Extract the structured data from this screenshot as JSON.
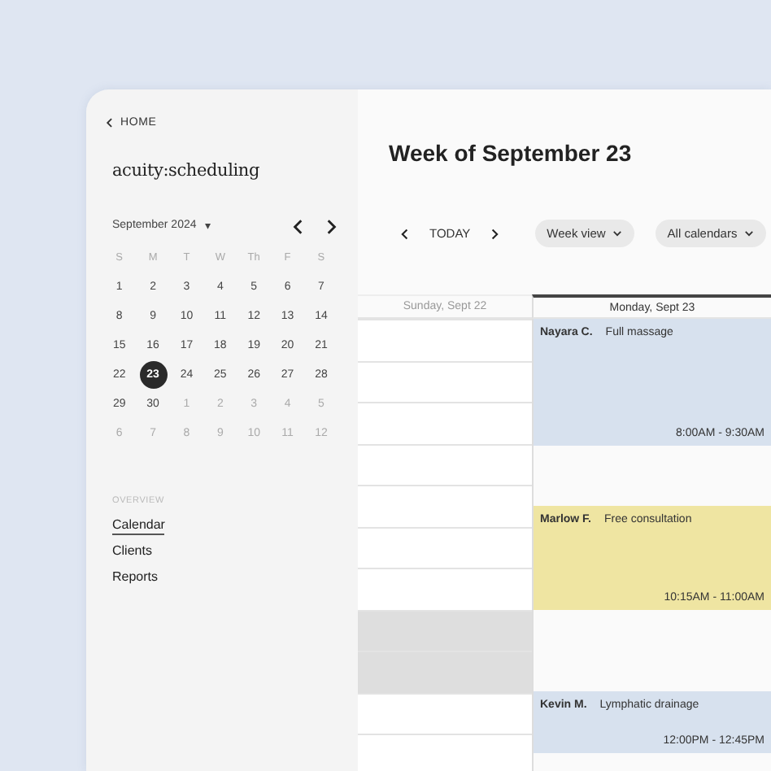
{
  "sidebar": {
    "back_link": "HOME",
    "logo": "acuity:scheduling",
    "mini_calendar": {
      "month": "September 2024",
      "caret": "▾",
      "weekdays": [
        "S",
        "M",
        "T",
        "W",
        "Th",
        "F",
        "S"
      ],
      "weeks": [
        [
          {
            "day": "1",
            "in_month": true,
            "selected": false
          },
          {
            "day": "2",
            "in_month": true,
            "selected": false
          },
          {
            "day": "3",
            "in_month": true,
            "selected": false
          },
          {
            "day": "4",
            "in_month": true,
            "selected": false
          },
          {
            "day": "5",
            "in_month": true,
            "selected": false
          },
          {
            "day": "6",
            "in_month": true,
            "selected": false
          },
          {
            "day": "7",
            "in_month": true,
            "selected": false
          }
        ],
        [
          {
            "day": "8",
            "in_month": true,
            "selected": false
          },
          {
            "day": "9",
            "in_month": true,
            "selected": false
          },
          {
            "day": "10",
            "in_month": true,
            "selected": false
          },
          {
            "day": "11",
            "in_month": true,
            "selected": false
          },
          {
            "day": "12",
            "in_month": true,
            "selected": false
          },
          {
            "day": "13",
            "in_month": true,
            "selected": false
          },
          {
            "day": "14",
            "in_month": true,
            "selected": false
          }
        ],
        [
          {
            "day": "15",
            "in_month": true,
            "selected": false
          },
          {
            "day": "16",
            "in_month": true,
            "selected": false
          },
          {
            "day": "17",
            "in_month": true,
            "selected": false
          },
          {
            "day": "18",
            "in_month": true,
            "selected": false
          },
          {
            "day": "19",
            "in_month": true,
            "selected": false
          },
          {
            "day": "20",
            "in_month": true,
            "selected": false
          },
          {
            "day": "21",
            "in_month": true,
            "selected": false
          }
        ],
        [
          {
            "day": "22",
            "in_month": true,
            "selected": false
          },
          {
            "day": "23",
            "in_month": true,
            "selected": true
          },
          {
            "day": "24",
            "in_month": true,
            "selected": false
          },
          {
            "day": "25",
            "in_month": true,
            "selected": false
          },
          {
            "day": "26",
            "in_month": true,
            "selected": false
          },
          {
            "day": "27",
            "in_month": true,
            "selected": false
          },
          {
            "day": "28",
            "in_month": true,
            "selected": false
          }
        ],
        [
          {
            "day": "29",
            "in_month": true,
            "selected": false
          },
          {
            "day": "30",
            "in_month": true,
            "selected": false
          },
          {
            "day": "1",
            "in_month": false,
            "selected": false
          },
          {
            "day": "2",
            "in_month": false,
            "selected": false
          },
          {
            "day": "3",
            "in_month": false,
            "selected": false
          },
          {
            "day": "4",
            "in_month": false,
            "selected": false
          },
          {
            "day": "5",
            "in_month": false,
            "selected": false
          }
        ],
        [
          {
            "day": "6",
            "in_month": false,
            "selected": false
          },
          {
            "day": "7",
            "in_month": false,
            "selected": false
          },
          {
            "day": "8",
            "in_month": false,
            "selected": false
          },
          {
            "day": "9",
            "in_month": false,
            "selected": false
          },
          {
            "day": "10",
            "in_month": false,
            "selected": false
          },
          {
            "day": "11",
            "in_month": false,
            "selected": false
          },
          {
            "day": "12",
            "in_month": false,
            "selected": false
          }
        ]
      ]
    },
    "section_label": "OVERVIEW",
    "nav": [
      {
        "label": "Calendar",
        "selected": true
      },
      {
        "label": "Clients",
        "selected": false
      },
      {
        "label": "Reports",
        "selected": false
      }
    ]
  },
  "main": {
    "title": "Week of September 23",
    "today": "TODAY",
    "view_select": "Week view",
    "calendar_select": "All calendars",
    "days": [
      {
        "label": "Sunday, Sept 22",
        "selected": false
      },
      {
        "label": "Monday, Sept 23",
        "selected": true
      }
    ],
    "sunday_slots": [
      {
        "blocked": false
      },
      {
        "blocked": false
      },
      {
        "blocked": false
      },
      {
        "blocked": false
      },
      {
        "blocked": false
      },
      {
        "blocked": false
      },
      {
        "blocked": false
      },
      {
        "blocked": true
      },
      {
        "blocked": true
      },
      {
        "blocked": false
      },
      {
        "blocked": false
      }
    ],
    "events": [
      {
        "client": "Nayara C.",
        "service": "Full massage",
        "time": "8:00AM - 9:30AM",
        "color": "#d7e1ee"
      },
      {
        "client": "Marlow F.",
        "service": "Free consultation",
        "time": "10:15AM - 11:00AM",
        "color": "#efe5a2"
      },
      {
        "client": "Kevin M.",
        "service": "Lymphatic drainage",
        "time": "12:00PM - 12:45PM",
        "color": "#d7e1ee"
      }
    ]
  }
}
